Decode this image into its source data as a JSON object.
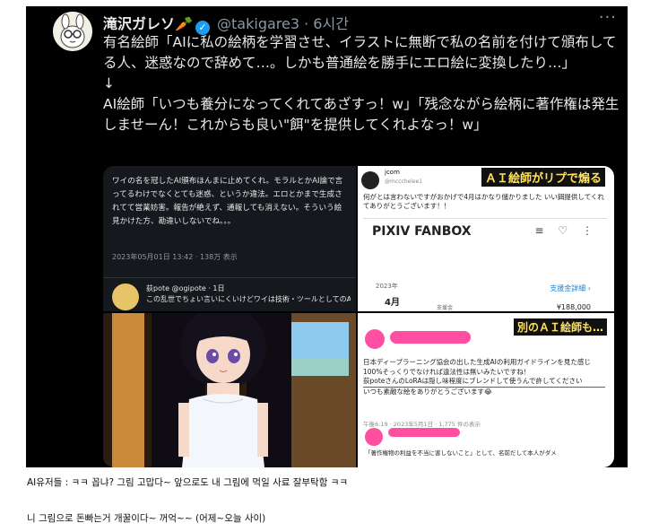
{
  "tweet": {
    "display_name": "滝沢ガレソ",
    "carrot": "🥕",
    "verified_badge": "✓",
    "handle": "@takigare3",
    "time": "· 6시간",
    "more": "···",
    "lines": [
      "有名絵師「AIに私の絵柄を学習させ、イラストに無断で私の名前を付けて頒布してる人、迷惑なので辞めて…。しかも普通絵を勝手にエロ絵に変換したり…」",
      "↓",
      "AI絵師「いつも養分になってくれてあざすっ！w」「残念ながら絵柄に著作権は発生しませーん！これからも良い\"餌\"を提供してくれよなっ！w」"
    ]
  },
  "media": {
    "panel1": {
      "text": "ワイの名を冠したAI頒布ほんまに止めてくれ。モラルとかAI論で言ってるわけでなくとても迷惑、というか違法。エロとかまで生成されてて営業妨害。報告が絶えず、通報しても消えない。そういう絵見かけた方、勘違いしないでね。。。",
      "meta": "2023年05月01日 13:42 · 138万 表示",
      "reply_name": "荻pote @ogipote · 1日",
      "reply_text": "この乱世でちょい言いにくいけどワイは技術・ツールとしてのAIは肯定派。"
    },
    "panel2": {
      "user": "jcom",
      "user_handle": "@mccchelee1",
      "caption": "ＡＩ絵師がリプで煽る",
      "body": "何がとは言わないですがおかげで4月はかなり儲かりました いい餌提供してくれてありがとうございます！！",
      "fanbox_title": "PIXIV FANBOX",
      "fanbox_icons": "≡ ♡ ⋮",
      "year": "2023年",
      "month": "4月",
      "sub": "支援金",
      "link": "支援金詳細 ›",
      "amount": "¥188,000"
    },
    "panel4": {
      "caption": "別のＡＩ絵師も…",
      "lines": [
        "日本ディープラーニング協会の出した生成AIの利用ガイドラインを見た感じ",
        "100%そっくりでなければ違法性は無いみたいですね！",
        "荻poteさんのLoRAは隠し味程度にブレンドして使うんで許してください",
        "いつも素敵な絵をありがとうございます😂"
      ],
      "meta": "午後6:19 · 2023年5月1日 · 1,775 件の表示",
      "reply": "「著作権物の利益を不当に害しないこと」として、名前だして本人がダメ"
    }
  },
  "captions": {
    "line1": "AI유저들 : ㅋㅋ 꼽냐? 그림 고맙다~ 앞으로도 내 그림에 먹일 사료 잘부탁함 ㅋㅋ",
    "line2": "니 그림으로 돈빠는거 개꿀이다~ 꺼억~~ (어제~오늘 사이)"
  }
}
